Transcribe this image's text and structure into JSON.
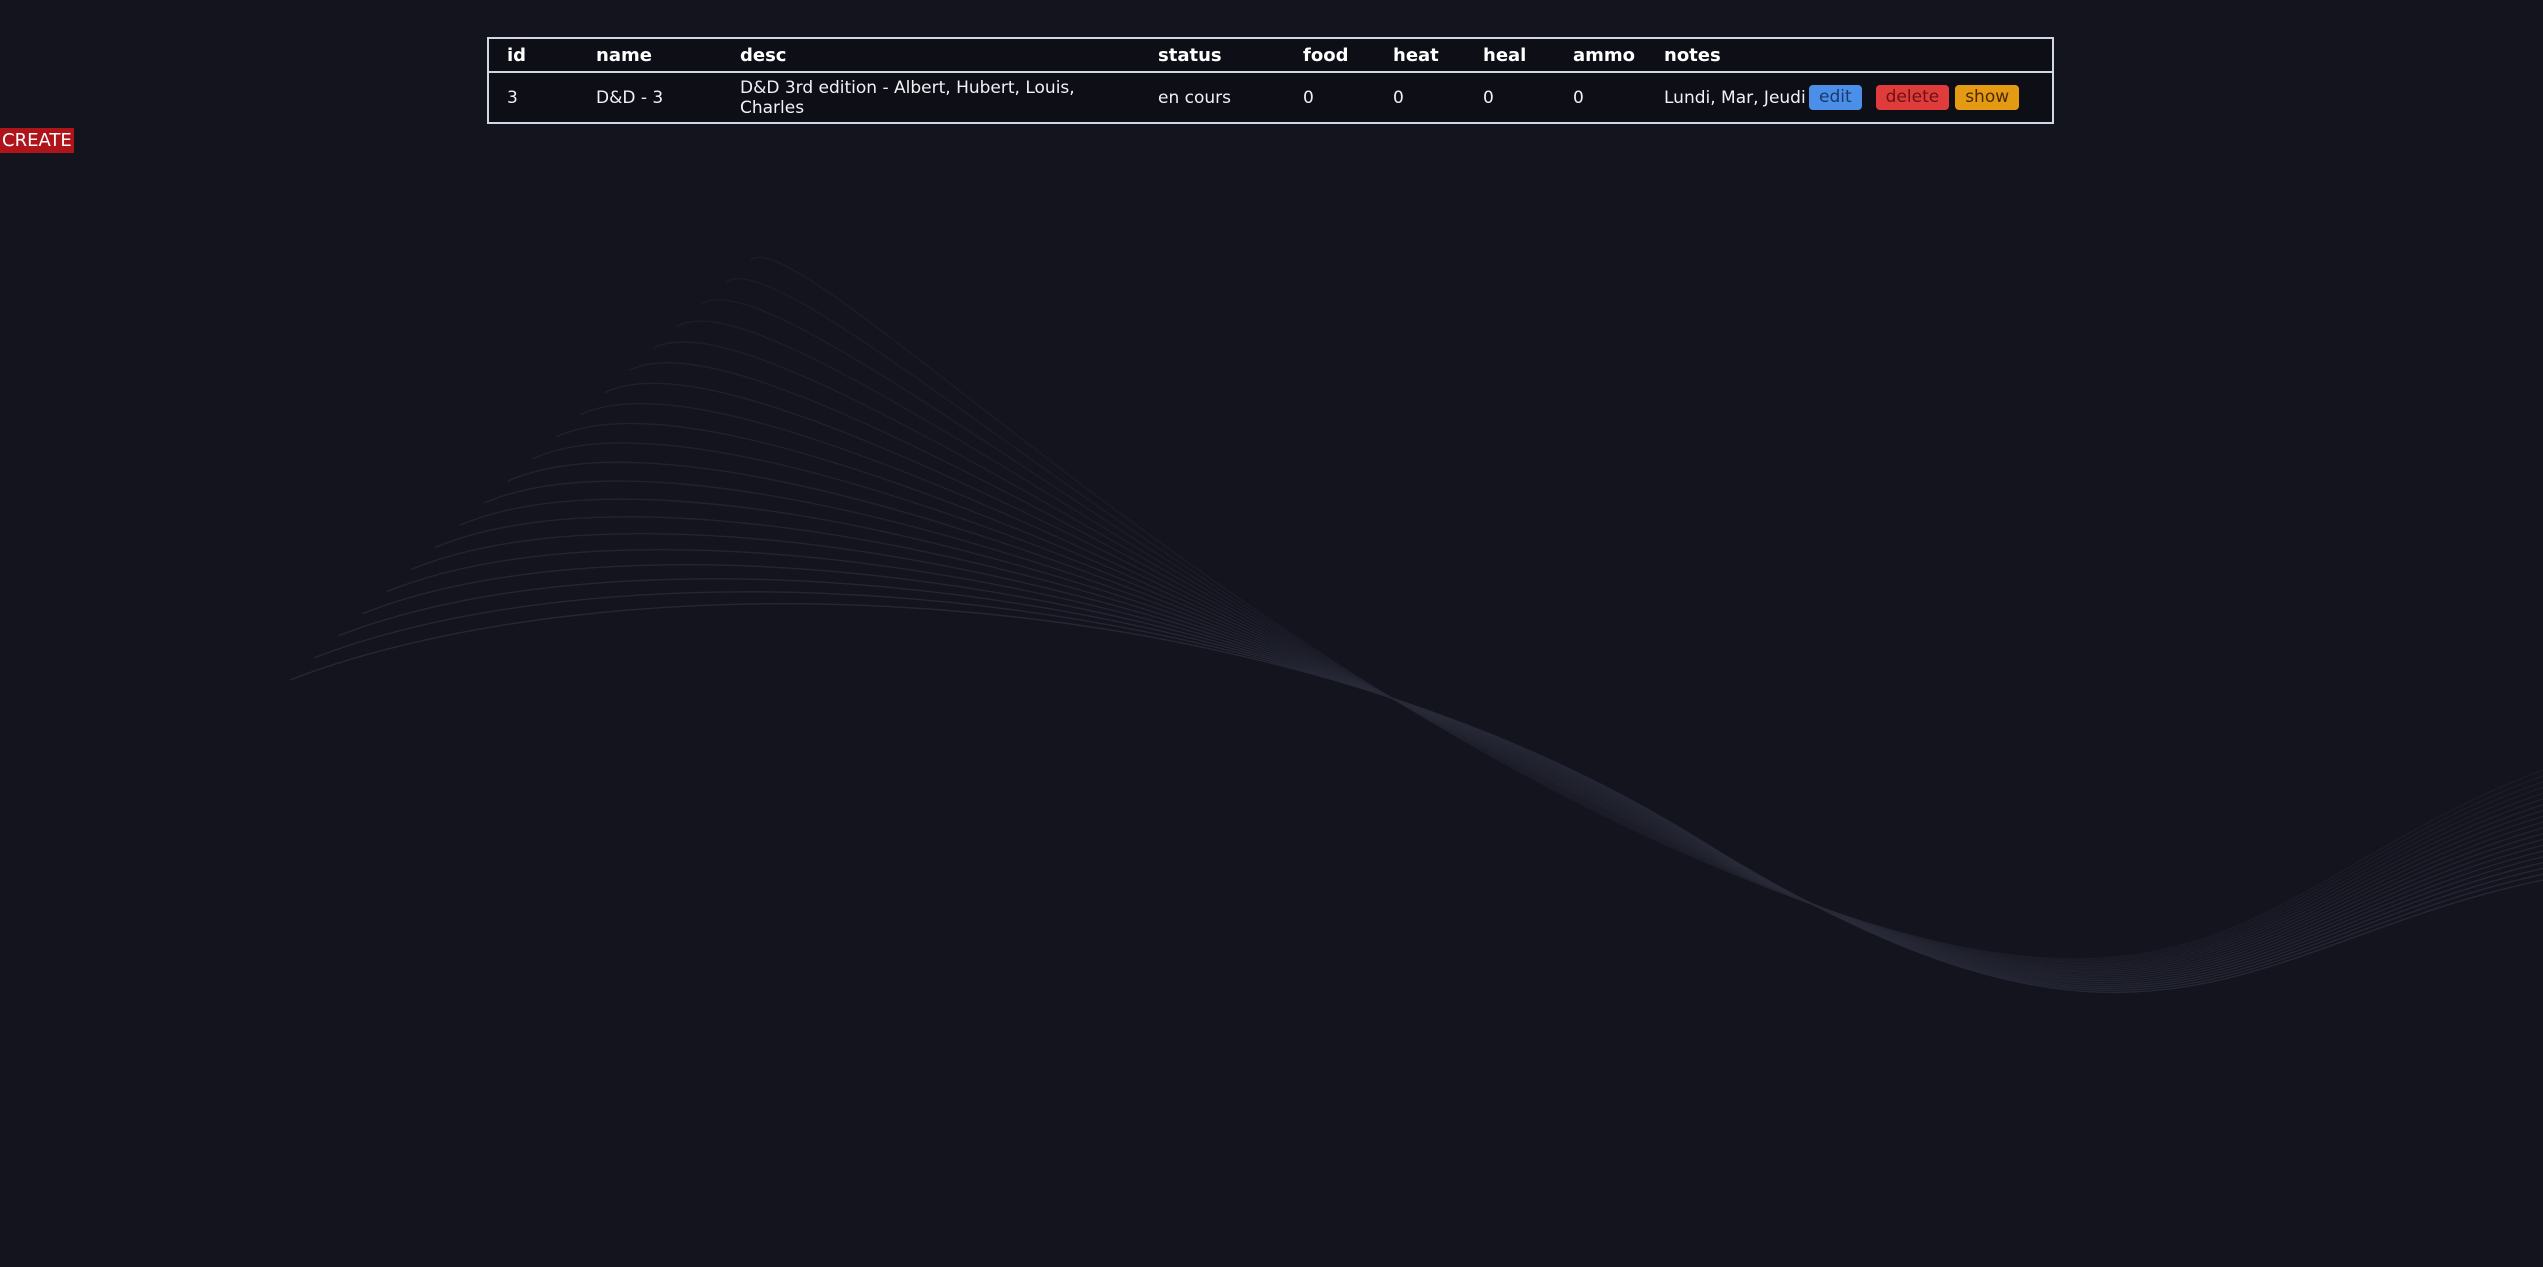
{
  "create_label": "CREATE",
  "table": {
    "headers": [
      "id",
      "name",
      "desc",
      "status",
      "food",
      "heat",
      "heal",
      "ammo",
      "notes"
    ],
    "rows": [
      {
        "id": "3",
        "name": "D&D - 3",
        "desc": "D&D 3rd edition - Albert, Hubert, Louis, Charles",
        "status": "en cours",
        "food": "0",
        "heat": "0",
        "heal": "0",
        "ammo": "0",
        "notes": "Lundi, Mar, Jeudi",
        "actions": {
          "edit": "edit",
          "delete": "delete",
          "show": "show"
        }
      }
    ]
  },
  "colors": {
    "background": "#13141e",
    "create": "#b0141b",
    "edit": "#4b8fe8",
    "delete": "#e03c3c",
    "show": "#e59a14"
  }
}
